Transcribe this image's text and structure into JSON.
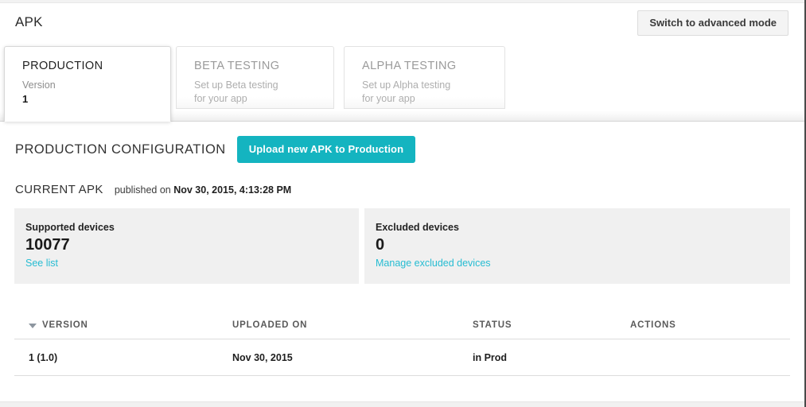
{
  "header": {
    "title": "APK",
    "advanced_mode_button": "Switch to advanced mode"
  },
  "tabs": [
    {
      "id": "production",
      "title": "PRODUCTION",
      "active": true,
      "line1": "Version",
      "line2": "1"
    },
    {
      "id": "beta-testing",
      "title": "BETA TESTING",
      "active": false,
      "line1": "Set up Beta testing",
      "line2": "for your app"
    },
    {
      "id": "alpha-testing",
      "title": "ALPHA TESTING",
      "active": false,
      "line1": "Set up Alpha testing",
      "line2": "for your app"
    }
  ],
  "main": {
    "section_title": "PRODUCTION CONFIGURATION",
    "upload_button": "Upload new APK to Production",
    "current_apk_label": "CURRENT APK",
    "published_prefix": "published on",
    "published_date": "Nov 30, 2015, 4:13:28 PM"
  },
  "panels": {
    "supported": {
      "label": "Supported devices",
      "count": "10077",
      "link": "See list"
    },
    "excluded": {
      "label": "Excluded devices",
      "count": "0",
      "link": "Manage excluded devices"
    }
  },
  "table": {
    "sort_icon": "caret-down-icon",
    "columns": [
      "VERSION",
      "UPLOADED ON",
      "STATUS",
      "ACTIONS"
    ],
    "rows": [
      {
        "version": "1 (1.0)",
        "uploaded_on": "Nov 30, 2015",
        "status": "in Prod",
        "actions": ""
      }
    ]
  },
  "colors": {
    "accent_teal": "#14b4c0",
    "link_cyan": "#26bcd2",
    "panel_bg": "#f0f0f0"
  }
}
